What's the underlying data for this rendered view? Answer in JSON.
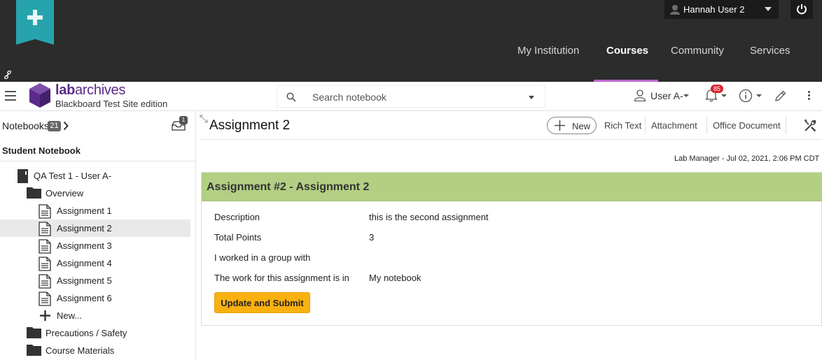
{
  "bb_header": {
    "user_name": "Hannah User 2",
    "nav": [
      "My Institution",
      "Courses",
      "Community",
      "Services"
    ],
    "active_nav": "Courses"
  },
  "la_header": {
    "brand": "labarchives",
    "edition": "Blackboard Test Site edition",
    "search_placeholder": "Search notebook",
    "user_label": "User A-",
    "notification_count": "85"
  },
  "sidebar": {
    "notebooks_label": "Notebooks",
    "notebooks_count": "21",
    "inbox_count": "1",
    "section_title": "Student Notebook",
    "tree": [
      {
        "label": "QA Test 1 - User A-",
        "kind": "notebook"
      },
      {
        "label": "Overview",
        "kind": "folder"
      },
      {
        "label": "Assignment 1",
        "kind": "page"
      },
      {
        "label": "Assignment 2",
        "kind": "page",
        "selected": true
      },
      {
        "label": "Assignment 3",
        "kind": "page"
      },
      {
        "label": "Assignment 4",
        "kind": "page"
      },
      {
        "label": "Assignment 5",
        "kind": "page"
      },
      {
        "label": "Assignment 6",
        "kind": "page"
      },
      {
        "label": "New...",
        "kind": "new"
      },
      {
        "label": "Precautions / Safety",
        "kind": "folder"
      },
      {
        "label": "Course Materials",
        "kind": "folder"
      }
    ]
  },
  "main": {
    "page_title": "Assignment 2",
    "toolbar": {
      "new_label": "New",
      "rich_text_label": "Rich Text",
      "attachment_label": "Attachment",
      "office_doc_label": "Office Document"
    },
    "meta": "Lab Manager - Jul 02, 2021, 2:06 PM CDT",
    "entry": {
      "header": "Assignment #2 - Assignment 2",
      "fields": [
        {
          "label": "Description",
          "value": "this is the second assignment"
        },
        {
          "label": "Total Points",
          "value": "3"
        },
        {
          "label": "I worked in a group with",
          "value": ""
        },
        {
          "label": "The work for this assignment is in",
          "value": "My notebook"
        }
      ],
      "submit_label": "Update and Submit"
    }
  },
  "colors": {
    "bb_bar": "#2c2c2c",
    "bb_teal": "#27a3ad",
    "la_purple": "#5b2a8a",
    "entry_header_green": "#b3cf83",
    "submit_orange": "#f9b111",
    "badge_red": "#d9232b"
  }
}
